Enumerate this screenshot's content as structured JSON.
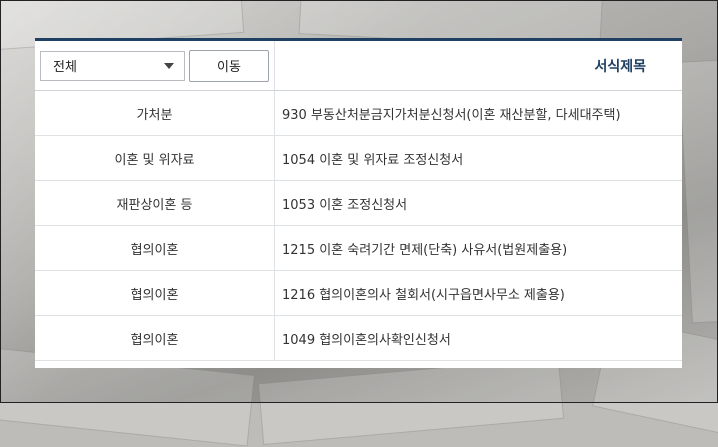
{
  "filter": {
    "category_select_value": "전체",
    "move_button_label": "이동",
    "column_header": "서식제목"
  },
  "rows": [
    {
      "category": "가처분",
      "title": "930 부동산처분금지가처분신청서(이혼 재산분할, 다세대주택)"
    },
    {
      "category": "이혼 및 위자료",
      "title": "1054 이혼 및 위자료 조정신청서"
    },
    {
      "category": "재판상이혼 등",
      "title": "1053 이혼 조정신청서"
    },
    {
      "category": "협의이혼",
      "title": "1215 이혼 숙려기간 면제(단축) 사유서(법원제출용)"
    },
    {
      "category": "협의이혼",
      "title": "1216 협의이혼의사 철회서(시구읍면사무소 제출용)"
    },
    {
      "category": "협의이혼",
      "title": "1049 협의이혼의사확인신청서"
    }
  ],
  "colors": {
    "accent": "#1f3f63",
    "border": "#dfe2e5"
  },
  "icons": {
    "select_caret": "chevron-down-icon"
  }
}
